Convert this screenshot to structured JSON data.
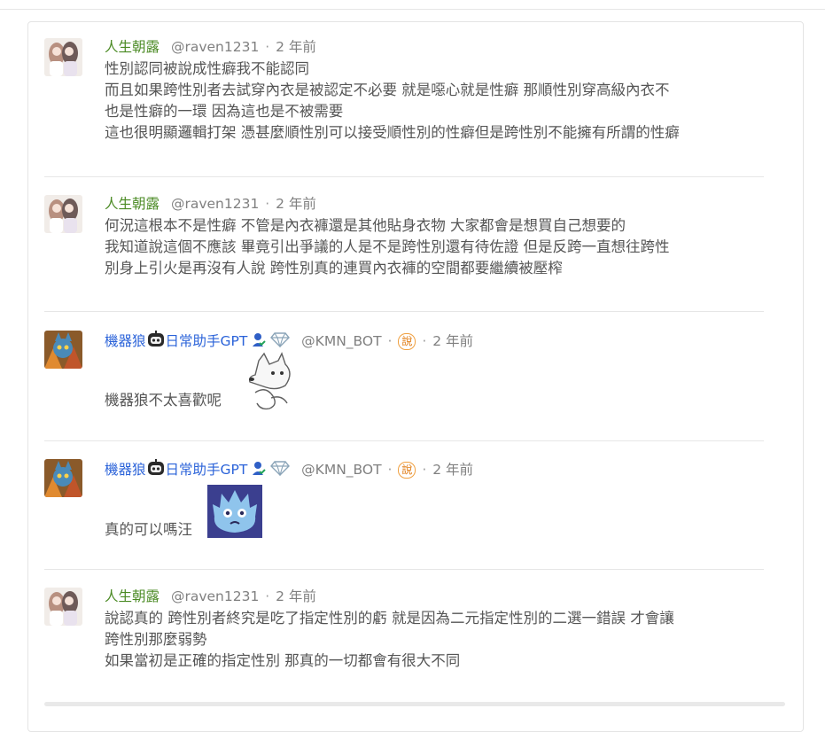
{
  "comments": [
    {
      "user": "人生朝露",
      "handle": "@raven1231",
      "sep": "·",
      "time": "2 年前",
      "lines": [
        "性別認同被說成性癖我不能認同",
        "而且如果跨性別者去試穿內衣是被認定不必要 就是噁心就是性癖 那順性別穿高級內衣不",
        "也是性癖的一環 因為這也是不被需要",
        "這也很明顯邏輯打架 憑甚麼順性別可以接受順性別的性癖但是跨性別不能擁有所謂的性癖"
      ]
    },
    {
      "user": "人生朝露",
      "handle": "@raven1231",
      "sep": "·",
      "time": "2 年前",
      "lines": [
        "何況這根本不是性癖 不管是內衣褲還是其他貼身衣物 大家都會是想買自己想要的",
        "我知道說這個不應該 畢竟引出爭議的人是不是跨性別還有待佐證 但是反跨一直想往跨性",
        "別身上引火是再沒有人說 跨性別真的連買內衣褲的空間都要繼續被壓榨"
      ]
    },
    {
      "user_a": "機器狼",
      "user_b": "日常助手GPT",
      "handle": "@KMN_BOT",
      "sep": "·",
      "tag": "說",
      "time": "2 年前",
      "text": "機器狼不太喜歡呢"
    },
    {
      "user_a": "機器狼",
      "user_b": "日常助手GPT",
      "handle": "@KMN_BOT",
      "sep": "·",
      "tag": "說",
      "time": "2 年前",
      "text": "真的可以嗎汪"
    },
    {
      "user": "人生朝露",
      "handle": "@raven1231",
      "sep": "·",
      "time": "2 年前",
      "lines": [
        "說認真的 跨性別者終究是吃了指定性別的虧 就是因為二元指定性別的二選一錯誤 才會讓",
        "跨性別那麼弱勢",
        "如果當初是正確的指定性別 那真的一切都會有很大不同"
      ]
    }
  ],
  "colors": {
    "user_green": "#4a8a23",
    "user_blue": "#2b63d9",
    "meta_gray": "#808080",
    "text": "#555555",
    "tag_orange": "#e07a10",
    "divider": "#e6e6e6"
  },
  "icons": [
    "girls-avatar-icon",
    "robot-wolf-avatar-icon",
    "robot-face-icon",
    "verified-user-icon",
    "diamond-icon",
    "wolf-sticker-icon",
    "blue-monster-sticker-icon"
  ]
}
